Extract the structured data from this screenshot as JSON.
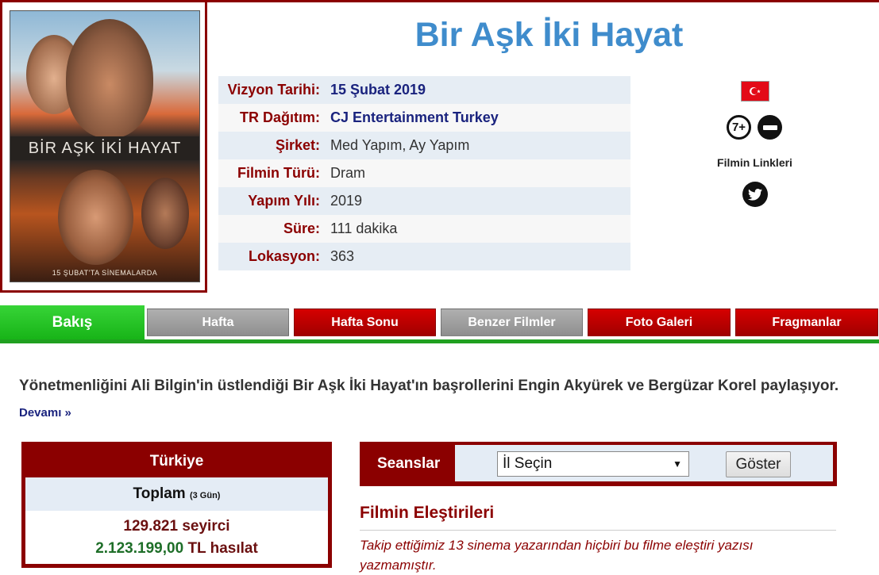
{
  "poster": {
    "title_text": "BİR AŞK İKİ HAYAT",
    "bottom_text": "15 ŞUBAT'TA SİNEMALARDA"
  },
  "movie": {
    "title": "Bir Aşk İki Hayat"
  },
  "info": [
    {
      "label": "Vizyon Tarihi:",
      "value": "15 Şubat 2019"
    },
    {
      "label": "TR Dağıtım:",
      "value": "CJ Entertainment Turkey"
    },
    {
      "label": "Şirket:",
      "value": "Med Yapım, Ay Yapım"
    },
    {
      "label": "Filmin Türü:",
      "value": "Dram"
    },
    {
      "label": "Yapım Yılı:",
      "value": "2019"
    },
    {
      "label": "Süre:",
      "value": "111 dakika"
    },
    {
      "label": "Lokasyon:",
      "value": "363"
    }
  ],
  "side": {
    "age_badge": "7+",
    "links_label": "Filmin Linkleri"
  },
  "tabs": [
    {
      "label": "Bakış",
      "style": "active"
    },
    {
      "label": "Hafta",
      "style": "gray"
    },
    {
      "label": "Hafta Sonu",
      "style": "red"
    },
    {
      "label": "Benzer Filmler",
      "style": "gray"
    },
    {
      "label": "Foto Galeri",
      "style": "red"
    },
    {
      "label": "Fragmanlar",
      "style": "red"
    }
  ],
  "summary": {
    "text": "Yönetmenliğini Ali Bilgin'in üstlendiği Bir Aşk İki Hayat'ın başrollerini Engin Akyürek ve Bergüzar Korel paylaşıyor.",
    "more": "Devamı »"
  },
  "boxoffice": {
    "country": "Türkiye",
    "total_label": "Toplam",
    "days": "(3 Gün)",
    "admissions": "129.821",
    "admissions_unit": "seyirci",
    "gross": "2.123.199,00",
    "gross_unit": "TL hasılat"
  },
  "sessions": {
    "label": "Seanslar",
    "select_value": "İl Seçin",
    "button": "Göster"
  },
  "reviews": {
    "title": "Filmin Eleştirileri",
    "text": "Takip ettiğimiz 13 sinema yazarından hiçbiri bu filme eleştiri yazısı yazmamıştır."
  },
  "colors": {
    "accent": "#8b0000",
    "title_blue": "#3f8ccc",
    "tab_green": "#20a020"
  }
}
